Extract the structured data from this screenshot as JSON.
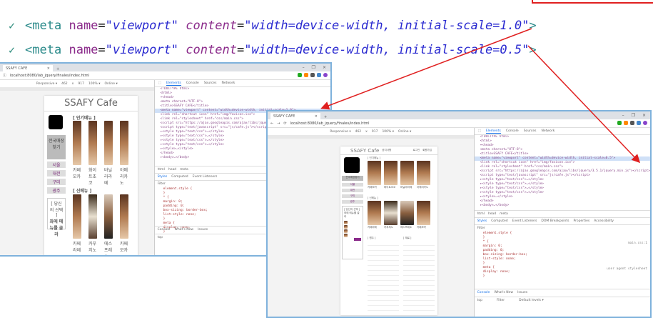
{
  "code_lines": [
    {
      "tag": "<meta",
      "attr1": "name",
      "val1": "\"viewport\"",
      "attr2": "content",
      "val2": "\"width=device-width, initial-scale=1.0\"",
      "close": ">"
    },
    {
      "tag": "<meta",
      "attr1": "name",
      "val1": "\"viewport\"",
      "attr2": "content",
      "val2": "\"width=device-width, initial-scale=0.5\"",
      "close": ">"
    }
  ],
  "browser": {
    "tab_title": "SSAFY CAFE",
    "url": "localhost:8080/lab_jquery/finales/index.html",
    "device_toolbar": {
      "mode": "Responsive ▾",
      "width": "462",
      "x": "x",
      "height": "917",
      "zoom": "100% ▾",
      "network": "Online ▾"
    },
    "devtools_tabs": [
      "Elements",
      "Console",
      "Sources",
      "Network"
    ],
    "dom_lines": [
      "<!DOCTYPE html>",
      "<html>",
      "▾<head>",
      "<meta charset=\"UTF-8\">",
      "<title>SSAFY CAFE</title>",
      "<meta name=\"viewport\" content=\"width=device-width, initial-scale=1.0\">",
      "<link rel=\"shortcut icon\" href=\"img/favicon.ico\">",
      "<link rel=\"stylesheet\" href=\"css/main.css\">",
      "<script src=\"https://ajax.googleapis.com/ajax/libs/jquery/3.5.1/jquery.min.js\"></script>",
      "<script type=\"text/javascript\" src=\"js/cafe.js\"></script>",
      "▸<style type=\"text/css\">…</style>",
      "▸<style type=\"text/css\">…</style>",
      "▸<style type=\"text/css\">…</style>",
      "▸<style type=\"text/css\">…</style>",
      "▸<style>…</style>",
      "</head>",
      "▸<body>…</body>"
    ],
    "dom_line_2": "<meta name=\"viewport\" content=\"width=device-width, initial-scale=0.5\">",
    "breadcrumb": [
      "html",
      "head",
      "meta"
    ],
    "style_tabs": [
      "Styles",
      "Computed",
      "Event Listeners",
      "DOM Breakpoints",
      "Properties",
      "Accessibility"
    ],
    "filter": "Filter",
    "css_lines": [
      "element.style {",
      "}",
      "* {",
      "margin: 0;",
      "padding: 0;",
      "box-sizing: border-box;",
      "list-style: none;",
      "}",
      "meta {",
      "display: none;",
      "}"
    ],
    "css_source": "main.css:1",
    "ua": "user agent stylesheet",
    "drawer_tabs": [
      "Console",
      "What's New",
      "Issues"
    ],
    "console_context": "top",
    "console_filter": "Filter",
    "levels": "Default levels ▾"
  },
  "site": {
    "title": "SSAFY Cafe",
    "top_links": [
      "공지사항",
      "로그인",
      "회원가입"
    ],
    "popular": "[ 인기메뉴 ]",
    "new": "[ 신메뉴 ]",
    "store_button": "전국매장찾기",
    "regions": [
      "서울",
      "대전",
      "구미",
      "광주"
    ],
    "choice": "[ 당신의 선택 ]",
    "choice_text": "좌에 메뉴를 골라",
    "popular_items": [
      "카페모카",
      "화이트초코",
      "바닐라라떼",
      "아메리카노"
    ],
    "new_items": [
      "카페라떼",
      "카푸치노",
      "에스프레소",
      "카페모카"
    ],
    "tables": [
      "[ 원두 ]",
      "[ 재료 ]"
    ]
  }
}
